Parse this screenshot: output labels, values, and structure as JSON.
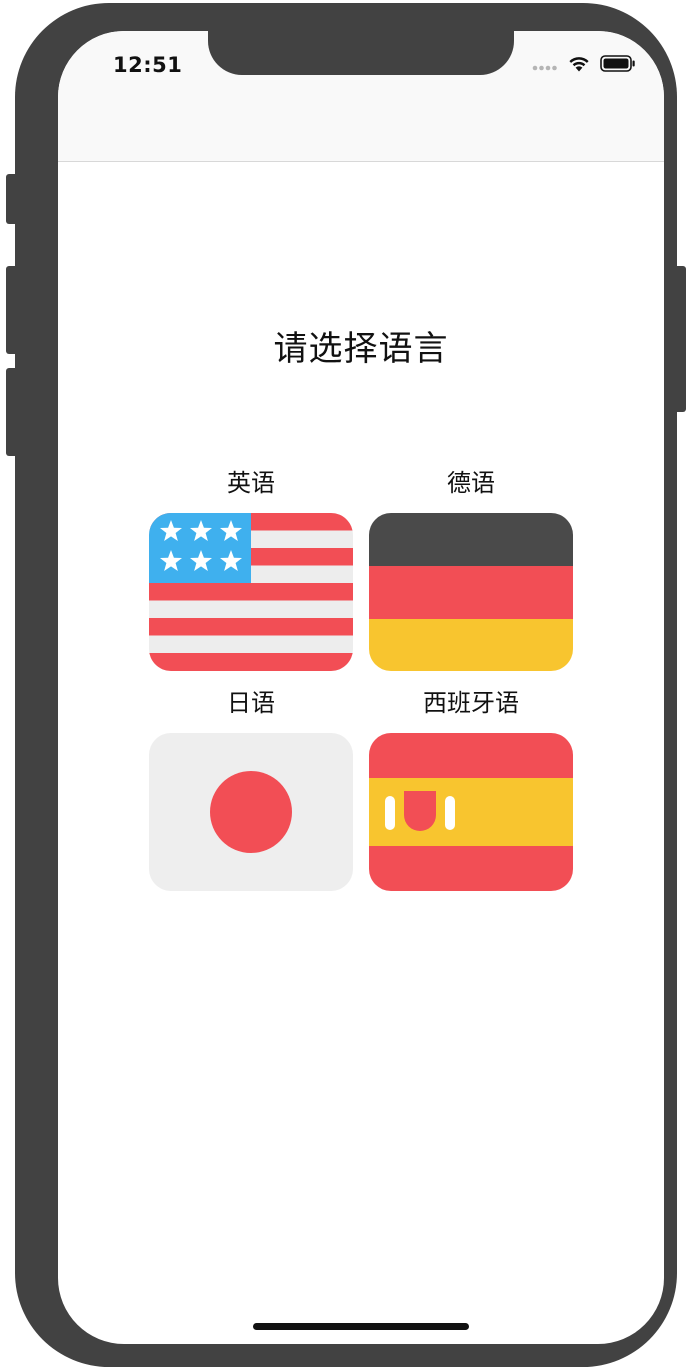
{
  "status_bar": {
    "time": "12:51"
  },
  "page": {
    "title": "请选择语言"
  },
  "languages": [
    {
      "label": "英语",
      "flag": "usa-flag-icon"
    },
    {
      "label": "德语",
      "flag": "germany-flag-icon"
    },
    {
      "label": "日语",
      "flag": "japan-flag-icon"
    },
    {
      "label": "西班牙语",
      "flag": "spain-flag-icon"
    }
  ],
  "colors": {
    "frame": "#424242",
    "red": "#F24E55",
    "blue": "#3FB0EE",
    "white_stripe": "#EDEDED",
    "dark": "#4A4A4A",
    "yellow": "#F8C52F",
    "japan_bg": "#EEEEEE"
  }
}
